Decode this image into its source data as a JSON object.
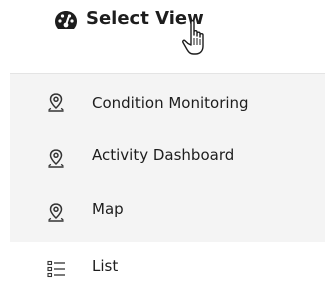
{
  "header": {
    "icon": "dashboard-gauge-icon",
    "title": "Select View"
  },
  "menu": {
    "items": [
      {
        "label": "Condition Monitoring",
        "icon": "location-pin-icon"
      },
      {
        "label": "Activity Dashboard",
        "icon": "location-pin-icon"
      },
      {
        "label": "Map",
        "icon": "location-pin-icon"
      },
      {
        "label": "List",
        "icon": "list-icon"
      }
    ]
  },
  "colors": {
    "text": "#1d1d1d",
    "menu_background": "#f4f4f4",
    "icon": "#333333"
  }
}
